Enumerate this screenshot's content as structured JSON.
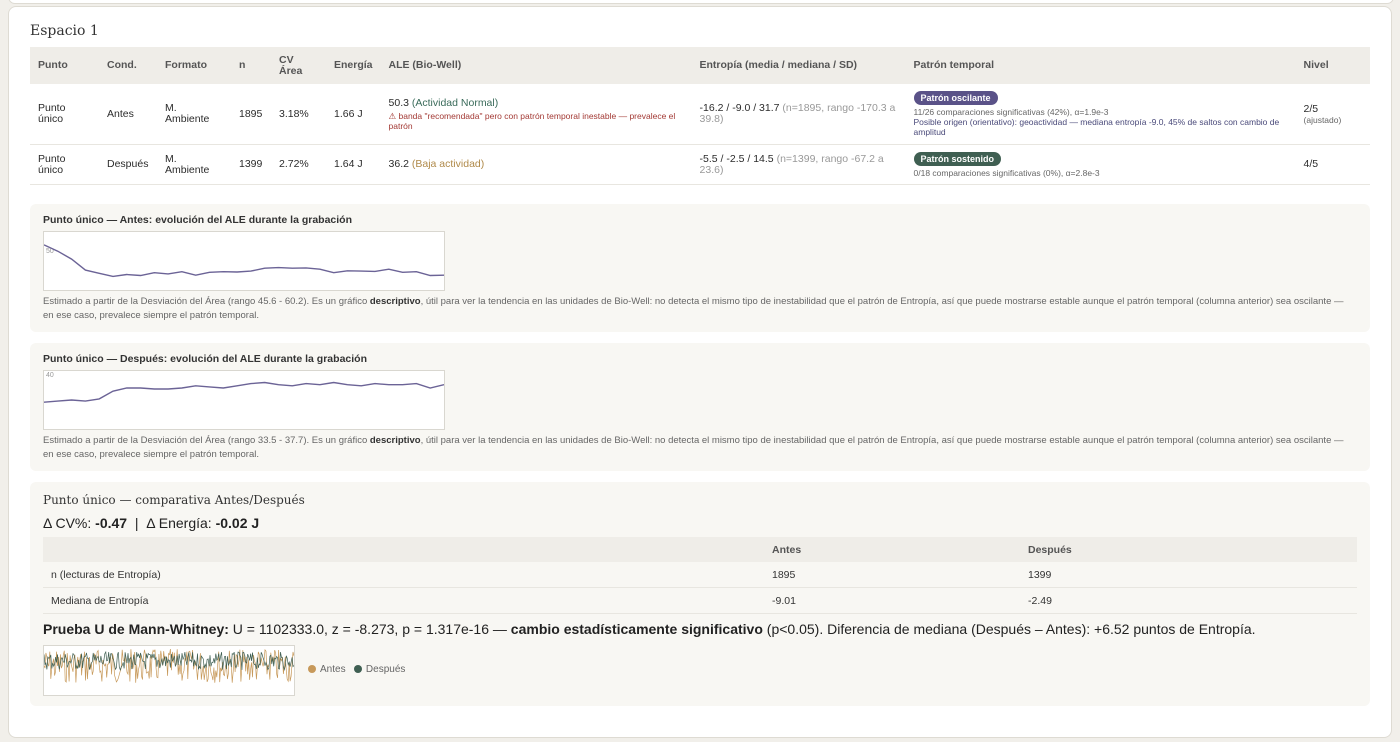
{
  "section_title": "Espacio 1",
  "table": {
    "headers": [
      "Punto",
      "Cond.",
      "Formato",
      "n",
      "CV Área",
      "Energía",
      "ALE (Bio-Well)",
      "Entropía (media / mediana / SD)",
      "Patrón temporal",
      "Nivel"
    ],
    "rows": [
      {
        "punto": "Punto único",
        "cond": "Antes",
        "formato": "M. Ambiente",
        "n": "1895",
        "cv": "3.18%",
        "energia": "1.66 J",
        "ale_value": "50.3",
        "ale_label": "(Actividad Normal)",
        "ale_warning": "⚠ banda \"recomendada\" pero con patrón temporal inestable — prevalece el patrón",
        "entropia_main": "-16.2 / -9.0 / 31.7",
        "entropia_extra": "(n=1895, rango -170.3 a 39.8)",
        "patron_badge": "Patrón oscilante",
        "patron_detail": "11/26 comparaciones significativas (42%), α=1.9e-3",
        "patron_origin": "Posible origen (orientativo): geoactividad — mediana entropía -9.0, 45% de saltos con cambio de amplitud",
        "nivel": "2/5",
        "nivel_note": "(ajustado)"
      },
      {
        "punto": "Punto único",
        "cond": "Después",
        "formato": "M. Ambiente",
        "n": "1399",
        "cv": "2.72%",
        "energia": "1.64 J",
        "ale_value": "36.2",
        "ale_label": "(Baja actividad)",
        "entropia_main": "-5.5 / -2.5 / 14.5",
        "entropia_extra": "(n=1399, rango -67.2 a 23.6)",
        "patron_badge": "Patrón sostenido",
        "patron_detail": "0/18 comparaciones significativas (0%), α=2.8e-3",
        "nivel": "4/5"
      }
    ]
  },
  "panel_antes": {
    "title": "Punto único — Antes: evolución del ALE durante la grabación",
    "axis_label": "50",
    "series": [
      58,
      56,
      53.5,
      50,
      49,
      48,
      48.6,
      48.3,
      49.2,
      48.8,
      49.5,
      48.4,
      49.3,
      49.5,
      49.4,
      49.7,
      50.6,
      50.8,
      50.6,
      50.7,
      50.3,
      49.2,
      49.8,
      49.7,
      49.6,
      50.3,
      49.3,
      49.5,
      48.3,
      48.4
    ],
    "ylim": [
      45.6,
      60.2
    ],
    "note_pre": "Estimado a partir de la Desviación del Área (rango 45.6 - 60.2). Es un gráfico ",
    "note_bold": "descriptivo",
    "note_post": ", útil para ver la tendencia en las unidades de Bio-Well: no detecta el mismo tipo de inestabilidad que el patrón de Entropía, así que puede mostrarse estable aunque el patrón temporal (columna anterior) sea oscilante — en ese caso, prevalece siempre el patrón temporal."
  },
  "panel_despues": {
    "title": "Punto único — Después: evolución del ALE durante la grabación",
    "axis_label": "40",
    "series": [
      35.4,
      35.5,
      35.6,
      35.5,
      35.7,
      36.4,
      36.7,
      36.7,
      36.6,
      36.6,
      36.7,
      36.9,
      36.8,
      36.7,
      36.9,
      37.1,
      37.2,
      37.0,
      36.9,
      37.1,
      37.0,
      37.2,
      37.0,
      36.9,
      37.1,
      37.0,
      37.0,
      37.1,
      36.7,
      37.0
    ],
    "ylim": [
      33.5,
      37.7
    ],
    "note_pre": "Estimado a partir de la Desviación del Área (rango 33.5 - 37.7). Es un gráfico ",
    "note_bold": "descriptivo",
    "note_post": ", útil para ver la tendencia en las unidades de Bio-Well: no detecta el mismo tipo de inestabilidad que el patrón de Entropía, así que puede mostrarse estable aunque el patrón temporal (columna anterior) sea oscilante — en ese caso, prevalece siempre el patrón temporal."
  },
  "comparison": {
    "title": "Punto único — comparativa Antes/Después",
    "delta_cv_label": "Δ CV%:",
    "delta_cv_value": "-0.47",
    "separator": "|",
    "delta_energy_label": "Δ Energía:",
    "delta_energy_value": "-0.02 J",
    "table_headers": [
      "",
      "Antes",
      "Después"
    ],
    "table_rows": [
      [
        "n (lecturas de Entropía)",
        "1895",
        "1399"
      ],
      [
        "Mediana de Entropía",
        "-9.01",
        "-2.49"
      ]
    ],
    "test_label": "Prueba U de Mann-Whitney:",
    "test_stats": " U = 1102333.0, z = -8.273, p = 1.317e-16 — ",
    "test_bold": "cambio estadísticamente significativo",
    "test_tail": " (p<0.05). Diferencia de mediana (Después – Antes): +6.52 puntos de Entropía.",
    "legend_antes": "Antes",
    "legend_despues": "Después"
  },
  "colors": {
    "line": "#6b6396",
    "antes": "#c7995a",
    "despues": "#3f5f52",
    "badge_oscilante": "#5a5288",
    "badge_sostenido": "#3f5f52"
  }
}
